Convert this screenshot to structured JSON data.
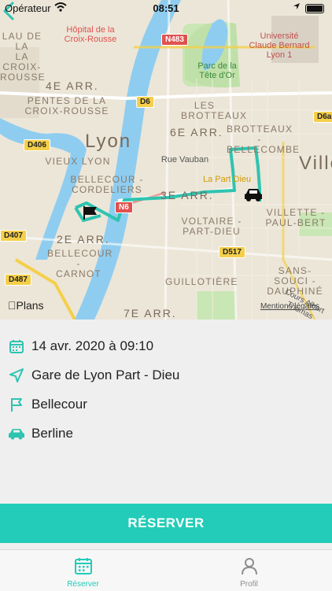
{
  "status_bar": {
    "carrier": "Opérateur",
    "time": "08:51"
  },
  "map": {
    "labels": {
      "croix_rousse_top": "LAU DE LA\nLA CROIX-\nROUSSE",
      "hopital": "Hôpital de la\nCroix-Rousse",
      "universite": "Université\nClaude Bernard\nLyon 1",
      "parc": "Parc de la\nTête d'Or",
      "arr4": "4E ARR.",
      "pentes": "PENTES DE LA\nCROIX-ROUSSE",
      "brotteaux": "LES\nBROTTEAUX",
      "arr6": "6E ARR.",
      "brotteaux_bellecombe": "BROTTEAUX -\nBELLECOMBE",
      "lyon": "Lyon",
      "vieux_lyon": "VIEUX LYON",
      "rue_vauban": "Rue Vauban",
      "part_dieu": "La Part Dieu",
      "ville": "Ville",
      "bellecour_cordeliers": "BELLECOUR -\nCORDELIERS",
      "arr3": "3E ARR.",
      "villette": "VILLETTE -\nPAUL-BERT",
      "voltaire": "VOLTAIRE -\nPART-DIEU",
      "arr2": "2E ARR.",
      "bellecour_carnot": "BELLECOUR -\nCARNOT",
      "guillotiere": "GUILLOTIÈRE",
      "sans_souci": "SANS-SOUCI -\nDAUPHINÉ",
      "arr7": "7E ARR.",
      "cours": "Cours Albert\nThomas"
    },
    "road_shields": {
      "n483": "N483",
      "d6": "D6",
      "d6a": "D6a",
      "d406": "D406",
      "n6": "N6",
      "d407": "D407",
      "d517": "D517",
      "d487": "D487"
    },
    "plans_label": "Plans",
    "legal_link": "Mentions légales",
    "route_color": "#2ec4b0"
  },
  "booking": {
    "datetime": "14 avr. 2020 à 09:10",
    "pickup": "Gare de Lyon Part - Dieu",
    "destination": "Bellecour",
    "vehicle": "Berline"
  },
  "cta": {
    "label": "RÉSERVER"
  },
  "tabs": [
    {
      "label": "Réserver",
      "active": true
    },
    {
      "label": "Profil",
      "active": false
    }
  ],
  "colors": {
    "accent": "#22ccb8",
    "icon": "#2ec4b0",
    "inactive": "#8e8e8e"
  }
}
